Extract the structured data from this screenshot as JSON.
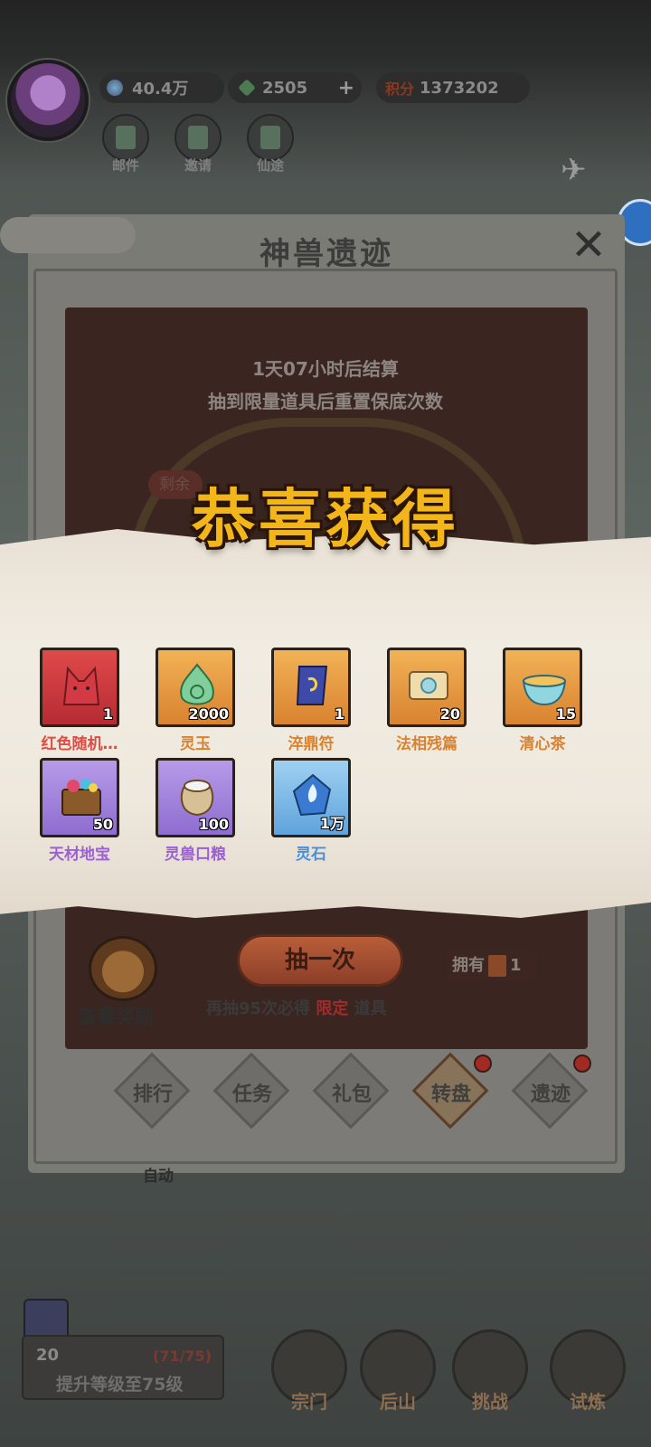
{
  "hud": {
    "spirit_stones": "40.4万",
    "jade": "2505",
    "jade_plus": "+",
    "points_tag": "积分",
    "points": "1373202",
    "buttons": [
      "邮件",
      "邀请",
      "仙途"
    ]
  },
  "panel": {
    "title": "神兽遗迹",
    "close_label": "✕",
    "timer": "1天07小时后结算",
    "reset_note": "抽到限量道具后重置保底次数",
    "remain_label": "剩余"
  },
  "reward": {
    "title": "恭喜获得",
    "items": [
      {
        "name": "红色随机…",
        "qty": "1",
        "rarity": "red"
      },
      {
        "name": "灵玉",
        "qty": "2000",
        "rarity": "orange"
      },
      {
        "name": "淬鼎符",
        "qty": "1",
        "rarity": "orange"
      },
      {
        "name": "法相残篇",
        "qty": "20",
        "rarity": "orange"
      },
      {
        "name": "清心茶",
        "qty": "15",
        "rarity": "orange"
      },
      {
        "name": "天材地宝",
        "qty": "50",
        "rarity": "purple"
      },
      {
        "name": "灵兽口粮",
        "qty": "100",
        "rarity": "purple"
      },
      {
        "name": "灵石",
        "qty": "1万",
        "rarity": "blue"
      }
    ]
  },
  "draw": {
    "view_reward": "查看奖励",
    "draw_once": "抽一次",
    "guarantee_prefix": "再抽95次必得",
    "guarantee_limited": "限定",
    "guarantee_suffix": "道具",
    "own_label": "拥有",
    "own_count": "1"
  },
  "tabs": [
    {
      "label": "排行",
      "dot": false
    },
    {
      "label": "任务",
      "dot": false
    },
    {
      "label": "礼包",
      "dot": false
    },
    {
      "label": "转盘",
      "dot": true,
      "active": true
    },
    {
      "label": "遗迹",
      "dot": true
    }
  ],
  "bottom": {
    "auto": "自动",
    "level": "20",
    "progress": "(71/75)",
    "upgrade_label": "提升等级至75级",
    "nav": [
      "宗门",
      "后山",
      "挑战",
      "试炼"
    ]
  }
}
